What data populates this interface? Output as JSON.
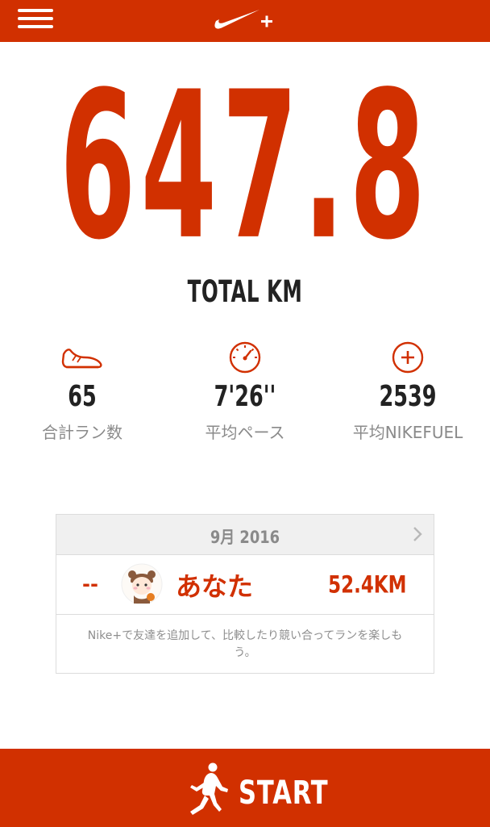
{
  "header": {
    "menu_icon": "hamburger-icon",
    "logo": "nike-plus-logo"
  },
  "summary": {
    "total_distance": "647.8",
    "total_label": "TOTAL KM"
  },
  "stats": [
    {
      "icon": "shoe-icon",
      "value": "65",
      "label": "合計ラン数"
    },
    {
      "icon": "speedometer-icon",
      "value": "7'26''",
      "label": "平均ペース"
    },
    {
      "icon": "nikefuel-icon",
      "value": "2539",
      "label": "平均NIKEFUEL"
    }
  ],
  "leaderboard": {
    "month": "9月 2016",
    "entries": [
      {
        "rank": "--",
        "name": "あなた",
        "distance": "52.4KM"
      }
    ],
    "note": "Nike+で友達を追加して、比較したり競い合ってランを楽しもう。"
  },
  "start": {
    "label": "START"
  },
  "colors": {
    "accent": "#d13000",
    "muted": "#8a8a8a"
  }
}
